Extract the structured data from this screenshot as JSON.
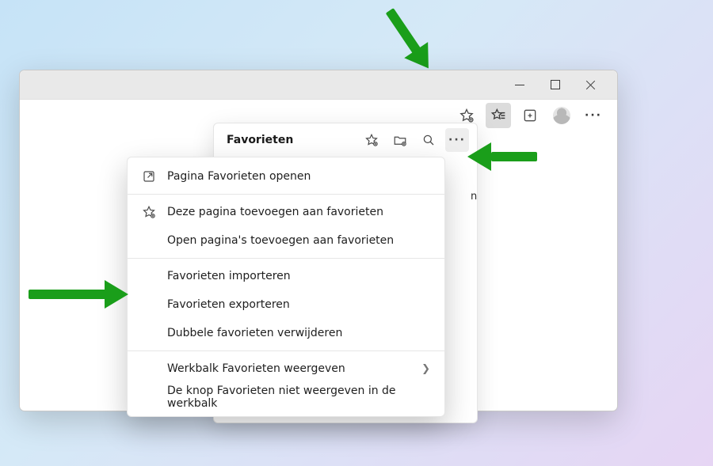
{
  "window": {
    "winbuttons": {
      "min": "minimize",
      "max": "maximize",
      "close": "close"
    }
  },
  "toolbar": {
    "addfav_title": "Deze pagina toevoegen aan favorieten",
    "favlist_title": "Favorieten",
    "collections_title": "Verzamelingen",
    "profile_title": "Profiel",
    "more_title": "Instellingen en meer",
    "more_glyph": "···"
  },
  "panel": {
    "title": "Favorieten",
    "star_title": "Deze pagina toevoegen aan favorieten",
    "folder_title": "Map toevoegen",
    "search_title": "Zoeken in favorieten",
    "more_title": "Meer opties",
    "more_glyph": "···",
    "row_text": "n co..."
  },
  "menu": {
    "open_page": "Pagina Favorieten openen",
    "add_this": "Deze pagina toevoegen aan favorieten",
    "add_open": "Open pagina's toevoegen aan favorieten",
    "import": "Favorieten importeren",
    "export": "Favorieten exporteren",
    "dedupe": "Dubbele favorieten verwijderen",
    "show_bar": "Werkbalk Favorieten weergeven",
    "hide_btn": "De knop Favorieten niet weergeven in de werkbalk",
    "chevron": "❯"
  }
}
